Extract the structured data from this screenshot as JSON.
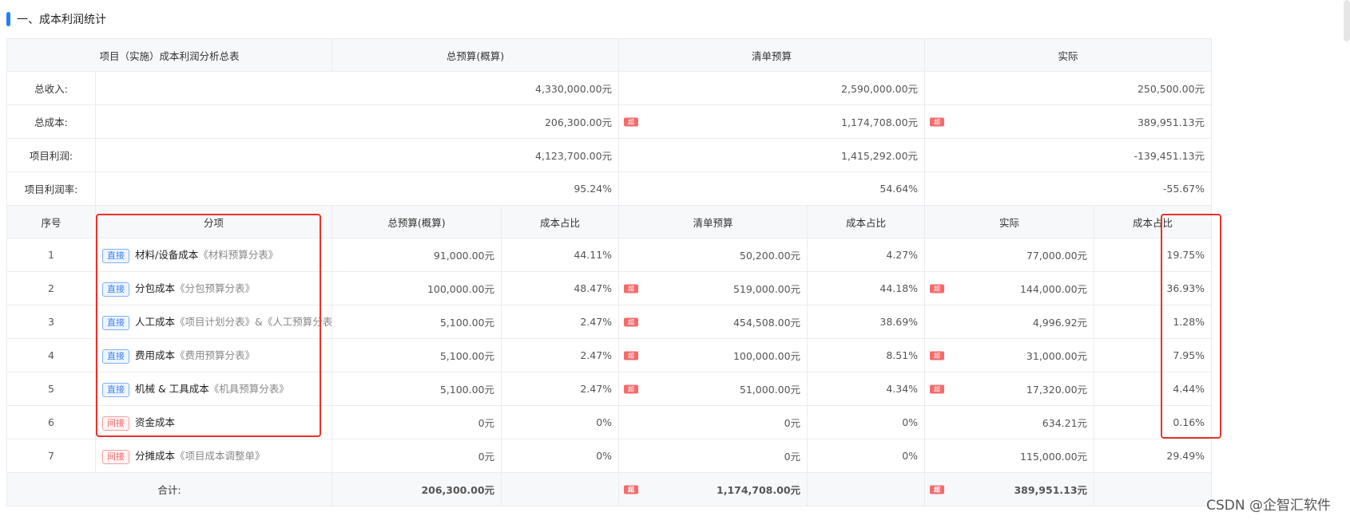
{
  "section": {
    "title": "一、成本利润统计"
  },
  "summary": {
    "headers": [
      "项目（实施）成本利润分析总表",
      "总预算(概算)",
      "清单预算",
      "实际"
    ],
    "rows": [
      {
        "label": "总收入:",
        "budget": "4,330,000.00元",
        "list": "2,590,000.00元",
        "actual": "250,500.00元",
        "list_flag": false,
        "actual_flag": false
      },
      {
        "label": "总成本:",
        "budget": "206,300.00元",
        "list": "1,174,708.00元",
        "actual": "389,951.13元",
        "list_flag": true,
        "actual_flag": true
      },
      {
        "label": "项目利润:",
        "budget": "4,123,700.00元",
        "list": "1,415,292.00元",
        "actual": "-139,451.13元",
        "list_flag": false,
        "actual_flag": false
      },
      {
        "label": "项目利润率:",
        "budget": "95.24%",
        "list": "54.64%",
        "actual": "-55.67%",
        "list_flag": false,
        "actual_flag": false
      }
    ]
  },
  "detail": {
    "headers": [
      "序号",
      "分项",
      "总预算(概算)",
      "成本占比",
      "清单预算",
      "成本占比",
      "实际",
      "成本占比"
    ],
    "flag_text": "超",
    "rows": [
      {
        "idx": "1",
        "tag": "直接",
        "tag_type": "direct",
        "name": "材料/设备成本",
        "ref": "《材料预算分表》",
        "budget": "91,000.00元",
        "budget_pct": "44.11%",
        "list": "50,200.00元",
        "list_flag": false,
        "list_pct": "4.27%",
        "actual": "77,000.00元",
        "actual_flag": false,
        "actual_pct": "19.75%"
      },
      {
        "idx": "2",
        "tag": "直接",
        "tag_type": "direct",
        "name": "分包成本",
        "ref": "《分包预算分表》",
        "budget": "100,000.00元",
        "budget_pct": "48.47%",
        "list": "519,000.00元",
        "list_flag": true,
        "list_pct": "44.18%",
        "actual": "144,000.00元",
        "actual_flag": true,
        "actual_pct": "36.93%"
      },
      {
        "idx": "3",
        "tag": "直接",
        "tag_type": "direct",
        "name": "人工成本",
        "ref": "《项目计划分表》&《人工预算分表》",
        "budget": "5,100.00元",
        "budget_pct": "2.47%",
        "list": "454,508.00元",
        "list_flag": true,
        "list_pct": "38.69%",
        "actual": "4,996.92元",
        "actual_flag": false,
        "actual_pct": "1.28%"
      },
      {
        "idx": "4",
        "tag": "直接",
        "tag_type": "direct",
        "name": "费用成本",
        "ref": "《费用预算分表》",
        "budget": "5,100.00元",
        "budget_pct": "2.47%",
        "list": "100,000.00元",
        "list_flag": true,
        "list_pct": "8.51%",
        "actual": "31,000.00元",
        "actual_flag": true,
        "actual_pct": "7.95%"
      },
      {
        "idx": "5",
        "tag": "直接",
        "tag_type": "direct",
        "name": "机械 & 工具成本",
        "ref": "《机具预算分表》",
        "budget": "5,100.00元",
        "budget_pct": "2.47%",
        "list": "51,000.00元",
        "list_flag": true,
        "list_pct": "4.34%",
        "actual": "17,320.00元",
        "actual_flag": true,
        "actual_pct": "4.44%"
      },
      {
        "idx": "6",
        "tag": "间接",
        "tag_type": "indirect",
        "name": "资金成本",
        "ref": "",
        "budget": "0元",
        "budget_pct": "0%",
        "list": "0元",
        "list_flag": false,
        "list_pct": "0%",
        "actual": "634.21元",
        "actual_flag": false,
        "actual_pct": "0.16%"
      },
      {
        "idx": "7",
        "tag": "间接",
        "tag_type": "indirect",
        "name": "分摊成本",
        "ref": "《项目成本调整单》",
        "budget": "0元",
        "budget_pct": "0%",
        "list": "0元",
        "list_flag": false,
        "list_pct": "0%",
        "actual": "115,000.00元",
        "actual_flag": false,
        "actual_pct": "29.49%"
      }
    ],
    "total": {
      "label": "合计:",
      "budget": "206,300.00元",
      "list": "1,174,708.00元",
      "list_flag": true,
      "actual": "389,951.13元",
      "actual_flag": true
    }
  },
  "watermark": "CSDN @企智汇软件"
}
